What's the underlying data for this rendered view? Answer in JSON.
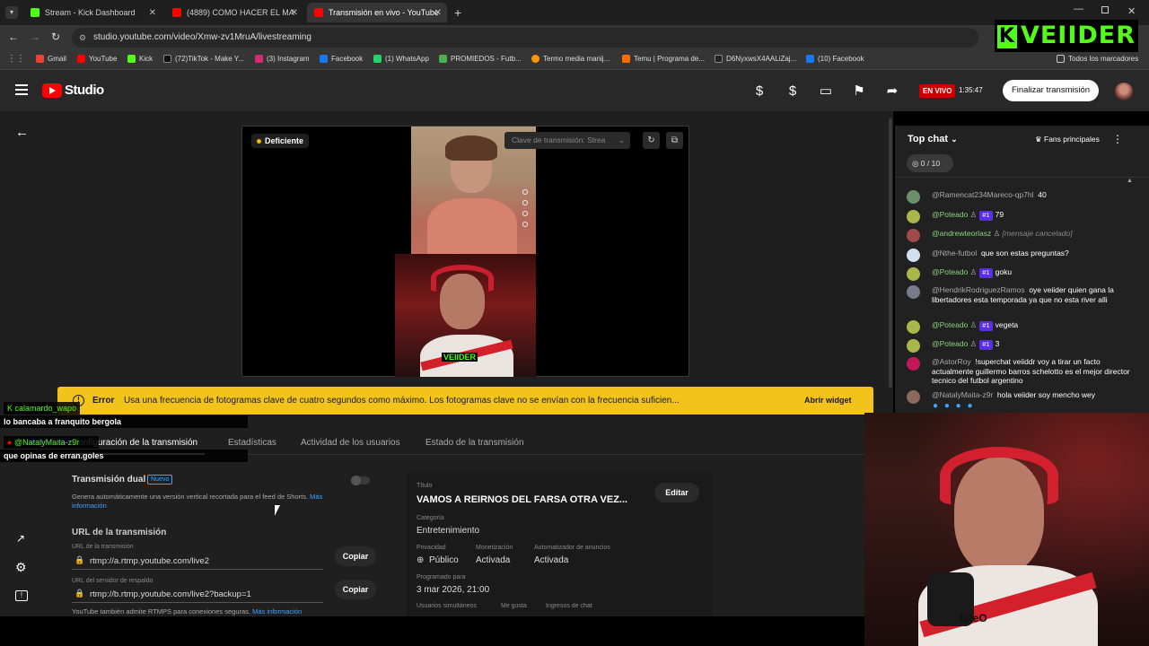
{
  "browser": {
    "tabs": [
      {
        "title": "Stream - Kick Dashboard",
        "color": "#53fc18"
      },
      {
        "title": "(4889) COMO HACER EL MATE",
        "color": "#ff0000"
      },
      {
        "title": "Transmisión en vivo - YouTube",
        "color": "#ff0000"
      }
    ],
    "url": "studio.youtube.com/video/Xmw-zv1MruA/livestreaming",
    "bookmarks": [
      "Gmail",
      "YouTube",
      "Kick",
      "(72)TikTok - Make Y...",
      "(3) Instagram",
      "Facebook",
      "(1) WhatsApp",
      "PROMIEDOS - Futb...",
      "Termo media manij...",
      "Temu | Programa de...",
      "D6NyxwsX4AALiZaj...",
      "(10) Facebook"
    ],
    "all_bookmarks": "Todos los marcadores"
  },
  "header": {
    "studio_label": "Studio",
    "live_badge": "EN VIVO",
    "live_time": "1:35:47",
    "end_button": "Finalizar transmisión"
  },
  "preview": {
    "health": "Deficiente",
    "stream_key_placeholder": "Clave de transmisión: Strea",
    "shirt_text": "VEIIDER"
  },
  "error": {
    "label": "Error",
    "text": "Usa una frecuencia de fotogramas clave de cuatro segundos como máximo. Los fotogramas clave no se envían con la frecuencia suficien...",
    "button": "Abrir widget"
  },
  "tabs": [
    "Configuración de la transmisión",
    "Estadísticas",
    "Actividad de los usuarios",
    "Estado de la transmisión"
  ],
  "settings": {
    "dual_title": "Transmisión dual",
    "dual_badge": "Nuevo",
    "dual_desc": "Genera automáticamente una versión vertical recortada para el feed de Shorts.",
    "dual_link": "Más información",
    "url_section": "URL de la transmisión",
    "url_label": "URL de la transmisión",
    "url_value": "rtmp://a.rtmp.youtube.com/live2",
    "backup_label": "URL del servidor de respaldo",
    "backup_value": "rtmp://b.rtmp.youtube.com/live2?backup=1",
    "copy": "Copiar",
    "rtmps_note": "YouTube también admite RTMPS para conexiones seguras.",
    "rtmps_link": "Más información"
  },
  "details": {
    "title_label": "Título",
    "title_value": "VAMOS A REIRNOS DEL FARSA OTRA VEZ...",
    "edit": "Editar",
    "category_label": "Categoría",
    "category_value": "Entretenimiento",
    "privacy_label": "Privacidad",
    "privacy_value": "Público",
    "monet_label": "Monetización",
    "monet_value": "Activada",
    "ads_label": "Automatizador de anuncios",
    "ads_value": "Activada",
    "sched_label": "Programado para",
    "sched_value": "3 mar 2026, 21:00",
    "concurrent_label": "Usuarios simultáneos",
    "likes_label": "Me gusta",
    "chat_label": "Ingresos de chat"
  },
  "chat": {
    "header": "Top chat",
    "fans": "Fans principales",
    "counter": "0 / 10",
    "messages": [
      {
        "name": "@Ramencat234Mareco-qp7hl",
        "text": "40",
        "mod": false,
        "badge": "",
        "color": "#6b8e6b"
      },
      {
        "name": "@Poteado",
        "text": "79",
        "mod": true,
        "badge": "#1",
        "color": "#a8b84a"
      },
      {
        "name": "@andrewteorlasz",
        "text": "[mensaje cancelado]",
        "mod": true,
        "badge": "",
        "color": "#a04a4a"
      },
      {
        "name": "@Nthe-futbol",
        "text": "que son estas preguntas?",
        "mod": false,
        "badge": "",
        "color": "#cfe0f0"
      },
      {
        "name": "@Poteado",
        "text": "goku",
        "mod": true,
        "badge": "#1",
        "color": "#a8b84a"
      },
      {
        "name": "@HendrikRodriguezRamos",
        "text": "oye veiider quien gana la libertadores esta temporada ya que no esta river alli",
        "mod": false,
        "badge": "",
        "color": "#7a7a8a"
      },
      {
        "name": "@Poteado",
        "text": "vegeta",
        "mod": true,
        "badge": "#1",
        "color": "#a8b84a"
      },
      {
        "name": "@Poteado",
        "text": "3",
        "mod": true,
        "badge": "#1",
        "color": "#a8b84a"
      },
      {
        "name": "@AstorRoy",
        "text": "!superchat veiiddr voy a tirar un facto actualmente guillermo barros schelotto es el mejor director tecnico del futbol argentino",
        "mod": false,
        "badge": "",
        "color": "#c2185b"
      },
      {
        "name": "@NatalyMaita-z9r",
        "text": "hola veiider soy mencho wey",
        "mod": false,
        "badge": "",
        "color": "#8a6a5a"
      }
    ]
  },
  "overlay": {
    "kick1_name": "calamardo_wapo",
    "kick1_msg": "lo bancaba a franquito bergola",
    "kick2_name": "@NatalyMaita-z9r",
    "kick2_msg": "que opinas de erran.goles",
    "logo": "VEIIDER",
    "shirt_text": "fateO"
  }
}
